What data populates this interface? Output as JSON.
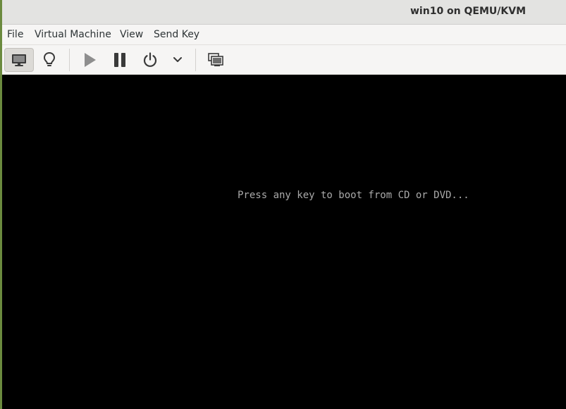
{
  "window": {
    "title": "win10 on QEMU/KVM"
  },
  "menu": {
    "items": [
      {
        "label": "File"
      },
      {
        "label": "Virtual Machine"
      },
      {
        "label": "View"
      },
      {
        "label": "Send Key"
      }
    ]
  },
  "toolbar": {
    "buttons": [
      {
        "icon": "monitor-icon",
        "active": true
      },
      {
        "icon": "lightbulb-icon",
        "active": false
      },
      {
        "icon": "play-icon",
        "active": false
      },
      {
        "icon": "pause-icon",
        "active": false
      },
      {
        "icon": "power-icon",
        "active": false
      },
      {
        "icon": "chevron-down-icon",
        "active": false
      },
      {
        "icon": "snapshots-icon",
        "active": false
      }
    ]
  },
  "console": {
    "message": "Press any key to boot from CD or DVD..."
  },
  "colors": {
    "titlebar": "#e3e3e1",
    "menubar": "#f6f5f4",
    "console_bg": "#000000",
    "console_text": "#aaaaaa"
  }
}
